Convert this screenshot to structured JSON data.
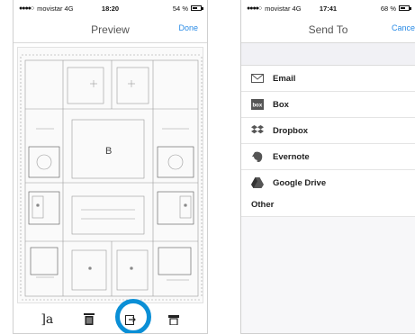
{
  "left_screen": {
    "status": {
      "carrier": "movistar 4G",
      "time": "18:20",
      "battery": "54 %"
    },
    "nav": {
      "title": "Preview",
      "done": "Done"
    },
    "preview": {
      "room_label": "B"
    },
    "toolbar": {
      "text_tool": "]a"
    },
    "accent_color": "#0a8fd6"
  },
  "right_screen": {
    "status": {
      "carrier": "movistar 4G",
      "time": "17:41",
      "battery": "68 %"
    },
    "nav": {
      "title": "Send To",
      "cancel": "Cance"
    },
    "services": [
      {
        "label": "Email",
        "icon": "envelope-icon"
      },
      {
        "label": "Box",
        "icon": "box-logo-icon"
      },
      {
        "label": "Dropbox",
        "icon": "dropbox-icon"
      },
      {
        "label": "Evernote",
        "icon": "evernote-icon"
      },
      {
        "label": "Google Drive",
        "icon": "google-drive-icon"
      }
    ],
    "other_label": "Other"
  }
}
